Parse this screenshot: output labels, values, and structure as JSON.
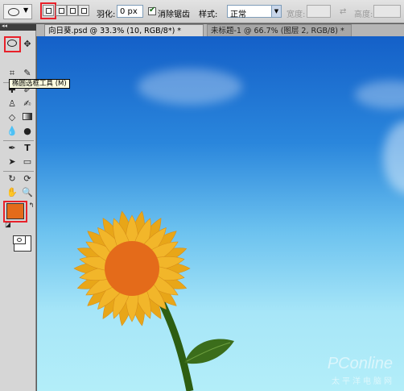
{
  "options_bar": {
    "feather_label": "羽化:",
    "feather_value": "0 px",
    "antialias_label": "消除锯齿",
    "style_label": "样式:",
    "style_value": "正常",
    "width_label": "宽度:",
    "height_label": "高度:"
  },
  "tabs": [
    {
      "label": "向日葵.psd @ 33.3% (10, RGB/8*) *"
    },
    {
      "label": "未标题-1 @ 66.7% (图层 2, RGB/8) *"
    }
  ],
  "toolbox": {
    "tooltip": "椭圆选框工具 (M)"
  },
  "colors": {
    "foreground": "#e46b1a",
    "background": "#ffffff",
    "highlight": "#e8212a"
  },
  "canvas": {
    "watermark": "PConline",
    "watermark_sub": "太平洋电脑网"
  }
}
